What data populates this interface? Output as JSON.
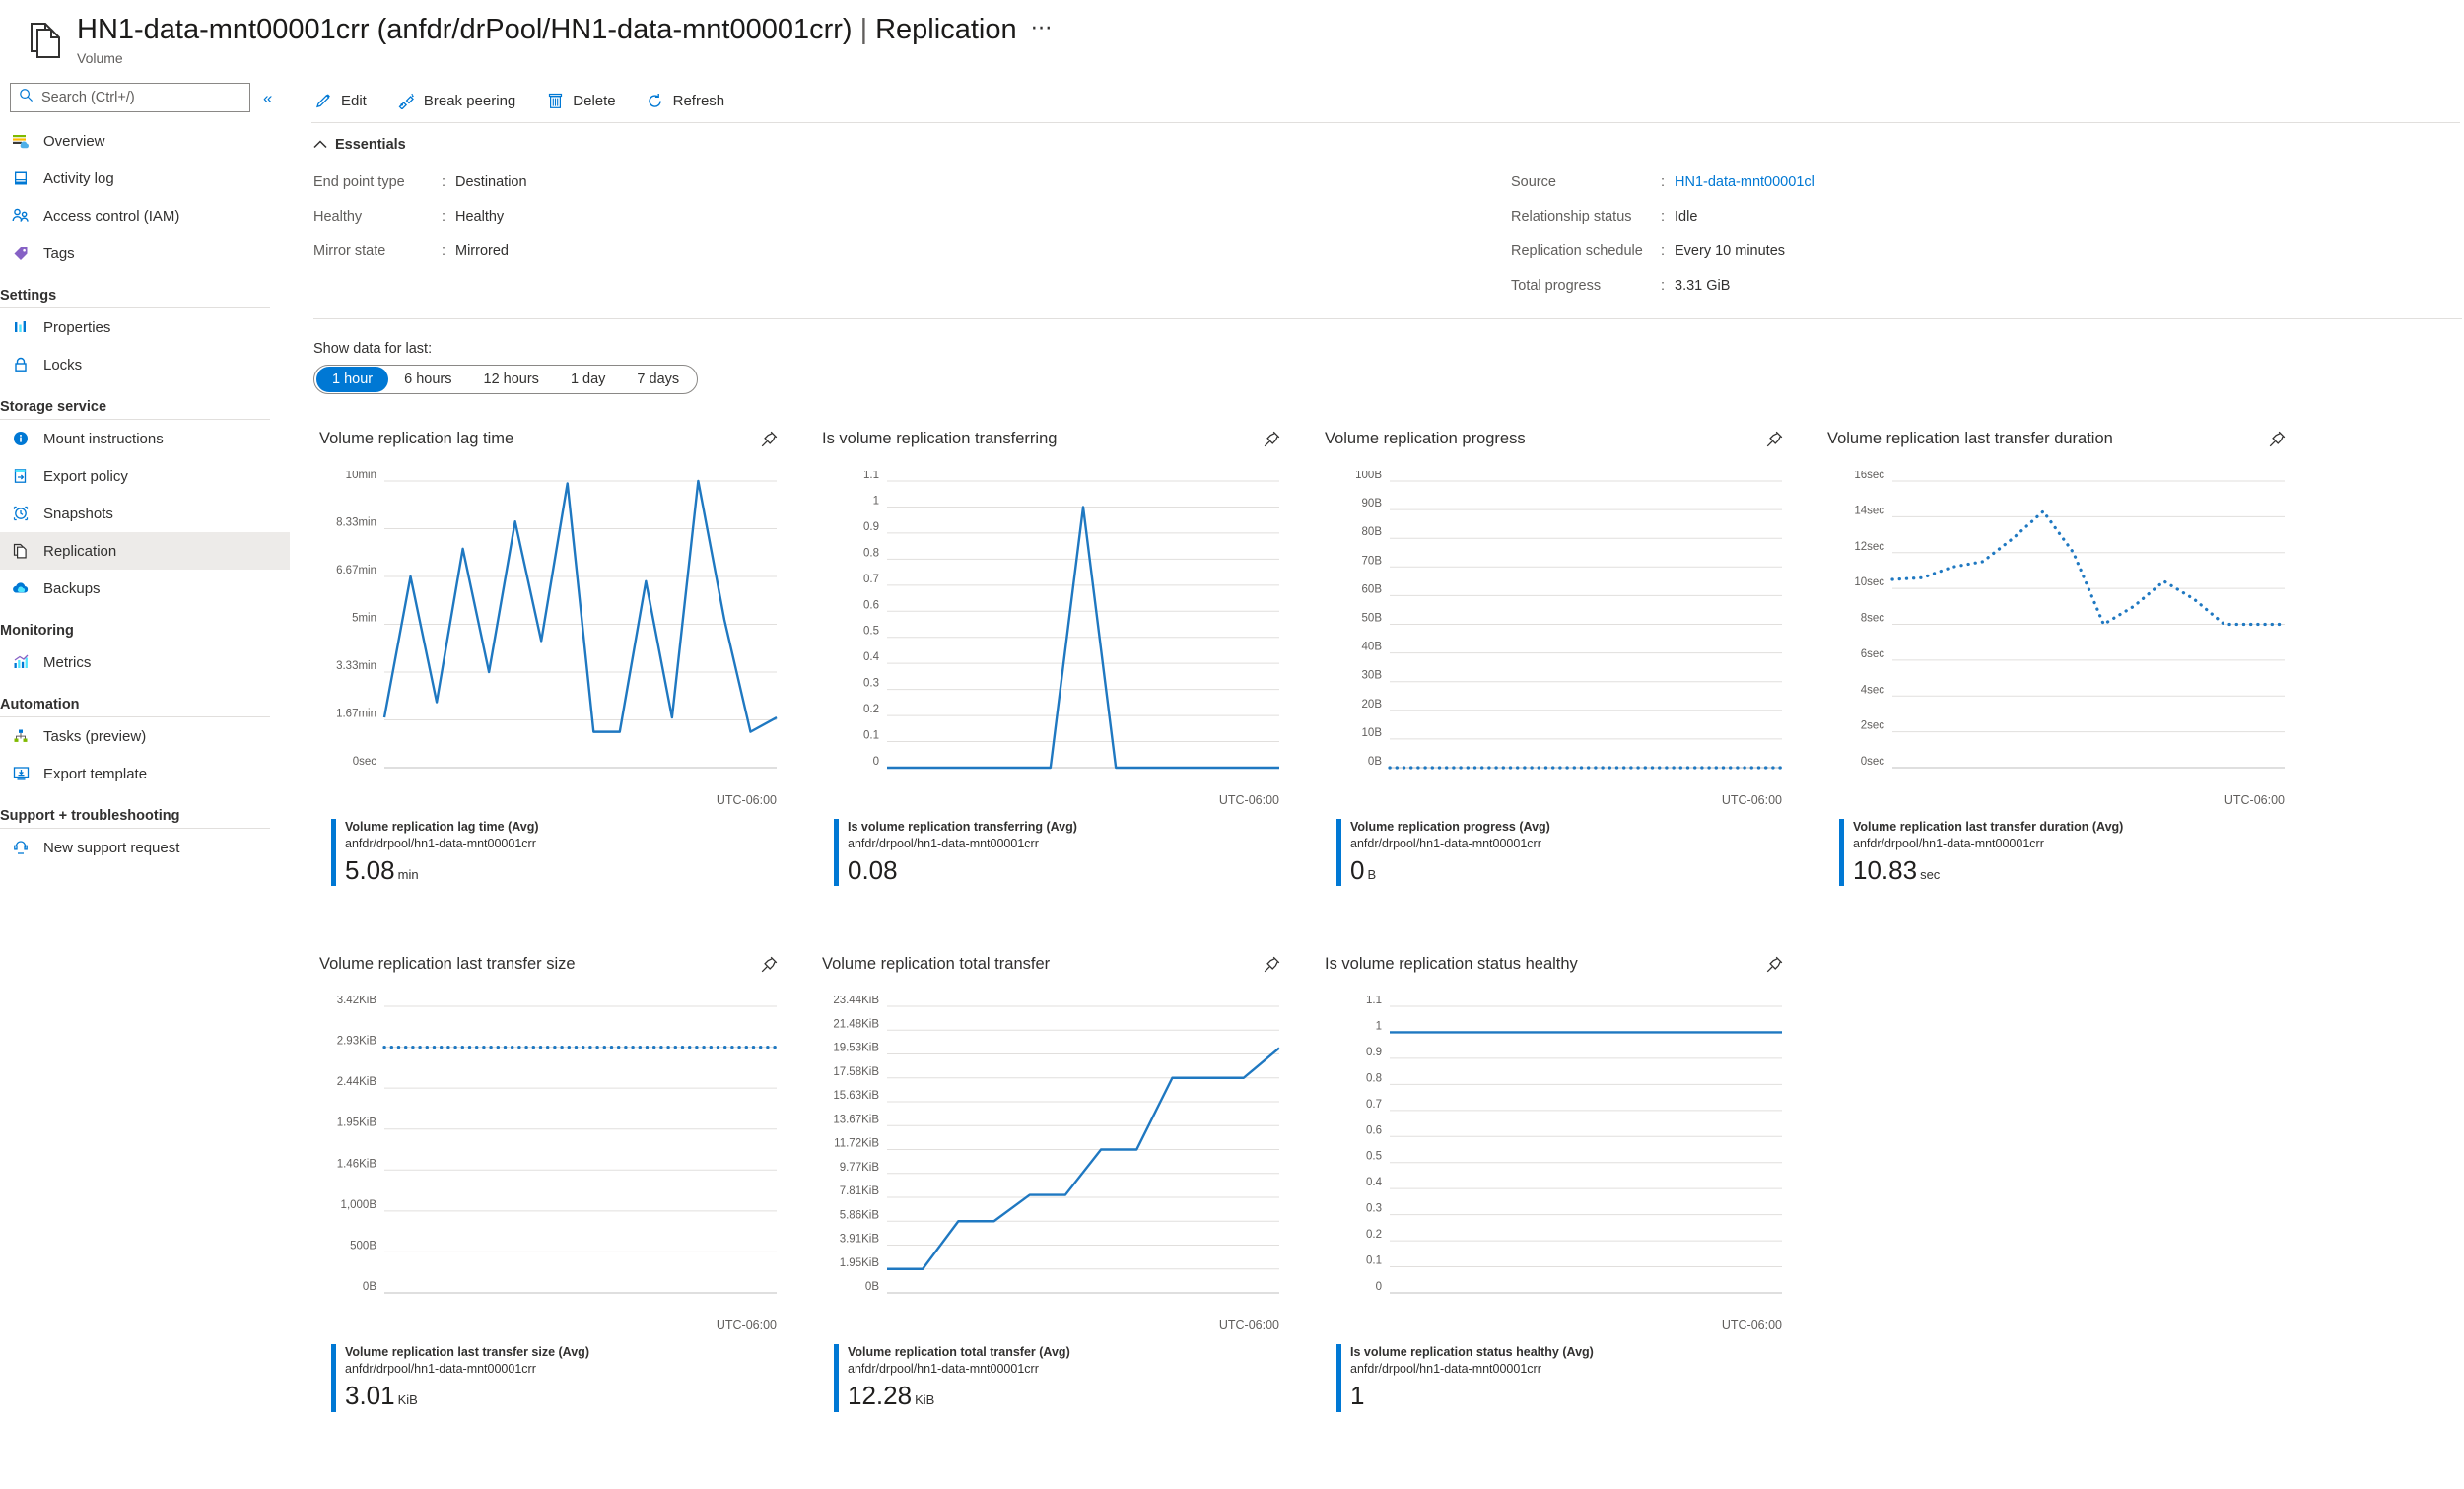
{
  "header": {
    "title": "HN1-data-mnt00001crr (anfdr/drPool/HN1-data-mnt00001crr)",
    "separator": "|",
    "section": "Replication",
    "more_label": "⋯",
    "subtitle": "Volume",
    "resource_icon": "volume-icon"
  },
  "sidebar": {
    "search": {
      "placeholder": "Search (Ctrl+/)",
      "value": "",
      "icon": "search-icon"
    },
    "collapse_icon": "double-chevron-left-icon",
    "items": [
      {
        "label": "Overview",
        "icon": "overview-icon",
        "selected": false
      },
      {
        "label": "Activity log",
        "icon": "activity-log-icon",
        "selected": false
      },
      {
        "label": "Access control (IAM)",
        "icon": "access-control-icon",
        "selected": false
      },
      {
        "label": "Tags",
        "icon": "tags-icon",
        "selected": false
      }
    ],
    "groups": [
      {
        "label": "Settings",
        "items": [
          {
            "label": "Properties",
            "icon": "properties-icon",
            "selected": false
          },
          {
            "label": "Locks",
            "icon": "lock-icon",
            "selected": false
          }
        ]
      },
      {
        "label": "Storage service",
        "items": [
          {
            "label": "Mount instructions",
            "icon": "info-icon",
            "selected": false
          },
          {
            "label": "Export policy",
            "icon": "export-policy-icon",
            "selected": false
          },
          {
            "label": "Snapshots",
            "icon": "snapshot-icon",
            "selected": false
          },
          {
            "label": "Replication",
            "icon": "replication-icon",
            "selected": true
          },
          {
            "label": "Backups",
            "icon": "backup-cloud-icon",
            "selected": false
          }
        ]
      },
      {
        "label": "Monitoring",
        "items": [
          {
            "label": "Metrics",
            "icon": "metrics-icon",
            "selected": false
          }
        ]
      },
      {
        "label": "Automation",
        "items": [
          {
            "label": "Tasks (preview)",
            "icon": "tasks-icon",
            "selected": false
          },
          {
            "label": "Export template",
            "icon": "export-template-icon",
            "selected": false
          }
        ]
      },
      {
        "label": "Support + troubleshooting",
        "items": [
          {
            "label": "New support request",
            "icon": "support-icon",
            "selected": false
          }
        ]
      }
    ]
  },
  "commandbar": [
    {
      "label": "Edit",
      "icon": "pencil-icon"
    },
    {
      "label": "Break peering",
      "icon": "break-peering-icon"
    },
    {
      "label": "Delete",
      "icon": "trash-icon"
    },
    {
      "label": "Refresh",
      "icon": "refresh-icon"
    }
  ],
  "essentials": {
    "header": "Essentials",
    "collapse_icon": "chevron-up-icon",
    "left": [
      {
        "key": "End point type",
        "value": "Destination"
      },
      {
        "key": "Healthy",
        "value": "Healthy"
      },
      {
        "key": "Mirror state",
        "value": "Mirrored"
      }
    ],
    "right": [
      {
        "key": "Source",
        "value": "HN1-data-mnt00001cl",
        "link": true
      },
      {
        "key": "Relationship status",
        "value": "Idle",
        "link": false
      },
      {
        "key": "Replication schedule",
        "value": "Every 10 minutes",
        "link": false
      },
      {
        "key": "Total progress",
        "value": "3.31 GiB",
        "link": false
      }
    ]
  },
  "time_selector": {
    "label": "Show data for last:",
    "options": [
      "1 hour",
      "6 hours",
      "12 hours",
      "1 day",
      "7 days"
    ],
    "selected": "1 hour"
  },
  "colors": {
    "accent": "#0078d4",
    "series": "#1f78c1",
    "gridline": "#e1dfdd",
    "axis_text": "#605e5c"
  },
  "chart_data": [
    {
      "type": "line",
      "title": "Volume replication lag time",
      "timezone": "UTC-06:00",
      "pin_icon": "pin-icon",
      "dashed": false,
      "ylabel": "",
      "xlabel": "",
      "yticks": [
        "10min",
        "8.33min",
        "6.67min",
        "5min",
        "3.33min",
        "1.67min",
        "0sec"
      ],
      "ytick_values": [
        600,
        500,
        400,
        300,
        200,
        100,
        0
      ],
      "ylim": [
        0,
        600
      ],
      "x": [
        0,
        1,
        2,
        3,
        4,
        5,
        6,
        7,
        8,
        9,
        10,
        11,
        12,
        13,
        14,
        15
      ],
      "values": [
        105,
        400,
        137,
        458,
        200,
        515,
        265,
        595,
        75,
        75,
        390,
        105,
        600,
        310,
        75,
        105
      ],
      "legend": {
        "name": "Volume replication lag time (Avg)",
        "resource": "anfdr/drpool/hn1-data-mnt00001crr",
        "value": "5.08",
        "unit": "min"
      }
    },
    {
      "type": "line",
      "title": "Is volume replication transferring",
      "timezone": "UTC-06:00",
      "pin_icon": "pin-icon",
      "dashed": false,
      "ylabel": "",
      "xlabel": "",
      "yticks": [
        "1.1",
        "1",
        "0.9",
        "0.8",
        "0.7",
        "0.6",
        "0.5",
        "0.4",
        "0.3",
        "0.2",
        "0.1",
        "0"
      ],
      "ytick_values": [
        1.1,
        1,
        0.9,
        0.8,
        0.7,
        0.6,
        0.5,
        0.4,
        0.3,
        0.2,
        0.1,
        0
      ],
      "ylim": [
        0,
        1.1
      ],
      "x": [
        0,
        1,
        2,
        3,
        4,
        5,
        6,
        7,
        8,
        9,
        10,
        11,
        12
      ],
      "values": [
        0,
        0,
        0,
        0,
        0,
        0,
        1,
        0,
        0,
        0,
        0,
        0,
        0
      ],
      "legend": {
        "name": "Is volume replication transferring (Avg)",
        "resource": "anfdr/drpool/hn1-data-mnt00001crr",
        "value": "0.08",
        "unit": ""
      }
    },
    {
      "type": "line",
      "title": "Volume replication progress",
      "timezone": "UTC-06:00",
      "pin_icon": "pin-icon",
      "dashed": true,
      "ylabel": "",
      "xlabel": "",
      "yticks": [
        "100B",
        "90B",
        "80B",
        "70B",
        "60B",
        "50B",
        "40B",
        "30B",
        "20B",
        "10B",
        "0B"
      ],
      "ytick_values": [
        100,
        90,
        80,
        70,
        60,
        50,
        40,
        30,
        20,
        10,
        0
      ],
      "ylim": [
        0,
        100
      ],
      "x": [
        0,
        1,
        2,
        3,
        4,
        5,
        6,
        7,
        8,
        9,
        10,
        11,
        12,
        13,
        14,
        15
      ],
      "values": [
        0,
        0,
        0,
        0,
        0,
        0,
        0,
        0,
        0,
        0,
        0,
        0,
        0,
        0,
        0,
        0
      ],
      "legend": {
        "name": "Volume replication progress (Avg)",
        "resource": "anfdr/drpool/hn1-data-mnt00001crr",
        "value": "0",
        "unit": "B"
      }
    },
    {
      "type": "line",
      "title": "Volume replication last transfer duration",
      "timezone": "UTC-06:00",
      "pin_icon": "pin-icon",
      "dashed": true,
      "ylabel": "",
      "xlabel": "",
      "yticks": [
        "16sec",
        "14sec",
        "12sec",
        "10sec",
        "8sec",
        "6sec",
        "4sec",
        "2sec",
        "0sec"
      ],
      "ytick_values": [
        16,
        14,
        12,
        10,
        8,
        6,
        4,
        2,
        0
      ],
      "ylim": [
        0,
        16
      ],
      "x": [
        0,
        1,
        2,
        3,
        4,
        5,
        6,
        7,
        8,
        9,
        10,
        11,
        12,
        13
      ],
      "values": [
        10.5,
        10.6,
        11.2,
        11.5,
        12.8,
        14.3,
        12.0,
        8.0,
        9.0,
        10.4,
        9.4,
        8.0,
        8.0,
        8.0
      ],
      "legend": {
        "name": "Volume replication last transfer duration (Avg)",
        "resource": "anfdr/drpool/hn1-data-mnt00001crr",
        "value": "10.83",
        "unit": "sec"
      }
    },
    {
      "type": "line",
      "title": "Volume replication last transfer size",
      "timezone": "UTC-06:00",
      "pin_icon": "pin-icon",
      "dashed": true,
      "ylabel": "",
      "xlabel": "",
      "yticks": [
        "3.42KiB",
        "2.93KiB",
        "2.44KiB",
        "1.95KiB",
        "1.46KiB",
        "1,000B",
        "500B",
        "0B"
      ],
      "ytick_values": [
        3500,
        3000,
        2500,
        2000,
        1500,
        1000,
        500,
        0
      ],
      "ylim": [
        0,
        3500
      ],
      "x": [
        0,
        1,
        2,
        3,
        4,
        5,
        6,
        7,
        8,
        9,
        10,
        11,
        12,
        13,
        14,
        15
      ],
      "values": [
        3000,
        3000,
        3000,
        3000,
        3000,
        3000,
        3000,
        3000,
        3000,
        3000,
        3000,
        3000,
        3000,
        3000,
        3000,
        3000
      ],
      "legend": {
        "name": "Volume replication last transfer size (Avg)",
        "resource": "anfdr/drpool/hn1-data-mnt00001crr",
        "value": "3.01",
        "unit": "KiB"
      }
    },
    {
      "type": "line",
      "title": "Volume replication total transfer",
      "timezone": "UTC-06:00",
      "pin_icon": "pin-icon",
      "dashed": false,
      "ylabel": "",
      "xlabel": "",
      "yticks": [
        "23.44KiB",
        "21.48KiB",
        "19.53KiB",
        "17.58KiB",
        "15.63KiB",
        "13.67KiB",
        "11.72KiB",
        "9.77KiB",
        "7.81KiB",
        "5.86KiB",
        "3.91KiB",
        "1.95KiB",
        "0B"
      ],
      "ytick_values": [
        24000,
        22000,
        20000,
        18000,
        16000,
        14000,
        12000,
        10000,
        8000,
        6000,
        4000,
        2000,
        0
      ],
      "ylim": [
        0,
        24000
      ],
      "x": [
        0,
        1,
        2,
        3,
        4,
        5,
        6,
        7,
        8,
        9,
        10,
        11
      ],
      "values": [
        2000,
        2000,
        6000,
        6000,
        8200,
        8200,
        12000,
        12000,
        18000,
        18000,
        18000,
        20500
      ],
      "legend": {
        "name": "Volume replication total transfer (Avg)",
        "resource": "anfdr/drpool/hn1-data-mnt00001crr",
        "value": "12.28",
        "unit": "KiB"
      }
    },
    {
      "type": "line",
      "title": "Is volume replication status healthy",
      "timezone": "UTC-06:00",
      "pin_icon": "pin-icon",
      "dashed": false,
      "ylabel": "",
      "xlabel": "",
      "yticks": [
        "1.1",
        "1",
        "0.9",
        "0.8",
        "0.7",
        "0.6",
        "0.5",
        "0.4",
        "0.3",
        "0.2",
        "0.1",
        "0"
      ],
      "ytick_values": [
        1.1,
        1,
        0.9,
        0.8,
        0.7,
        0.6,
        0.5,
        0.4,
        0.3,
        0.2,
        0.1,
        0
      ],
      "ylim": [
        0,
        1.1
      ],
      "x": [
        0,
        1,
        2,
        3,
        4,
        5,
        6,
        7,
        8,
        9,
        10
      ],
      "values": [
        1,
        1,
        1,
        1,
        1,
        1,
        1,
        1,
        1,
        1,
        1
      ],
      "legend": {
        "name": "Is volume replication status healthy (Avg)",
        "resource": "anfdr/drpool/hn1-data-mnt00001crr",
        "value": "1",
        "unit": ""
      }
    }
  ]
}
